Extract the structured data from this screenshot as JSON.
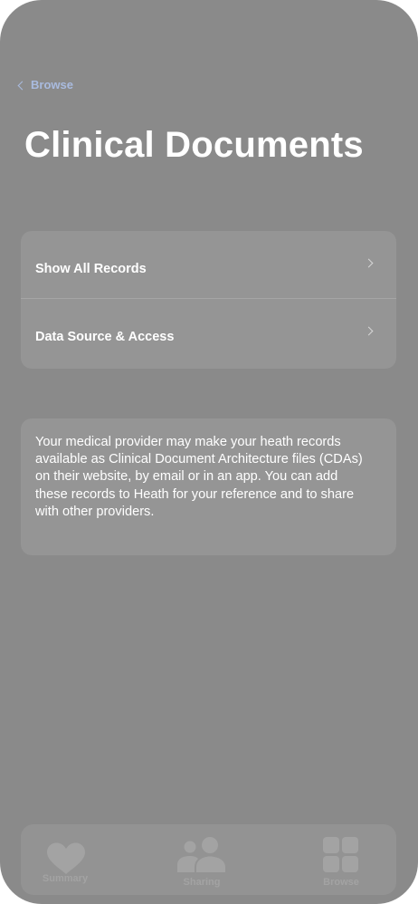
{
  "nav": {
    "back_label": "Browse"
  },
  "page": {
    "title": "Clinical Documents"
  },
  "menu": {
    "items": [
      {
        "label": "Show All Records"
      },
      {
        "label": "Data Source & Access"
      }
    ]
  },
  "info": {
    "text": "Your medical provider may make your heath records available as Clinical Document Architecture files (CDAs) on their website, by email or in an app. You can add these records to Heath for your reference and to share with other providers."
  },
  "tab_bar": {
    "tabs": [
      {
        "label": "Summary",
        "icon": "heart-icon"
      },
      {
        "label": "Sharing",
        "icon": "people-icon"
      },
      {
        "label": "Browse",
        "icon": "grid-icon"
      }
    ]
  },
  "colors": {
    "background": "#8a8a8a",
    "card": "#959595",
    "accent": "#a9bbdf",
    "tab_inactive": "#a3a3a3"
  }
}
